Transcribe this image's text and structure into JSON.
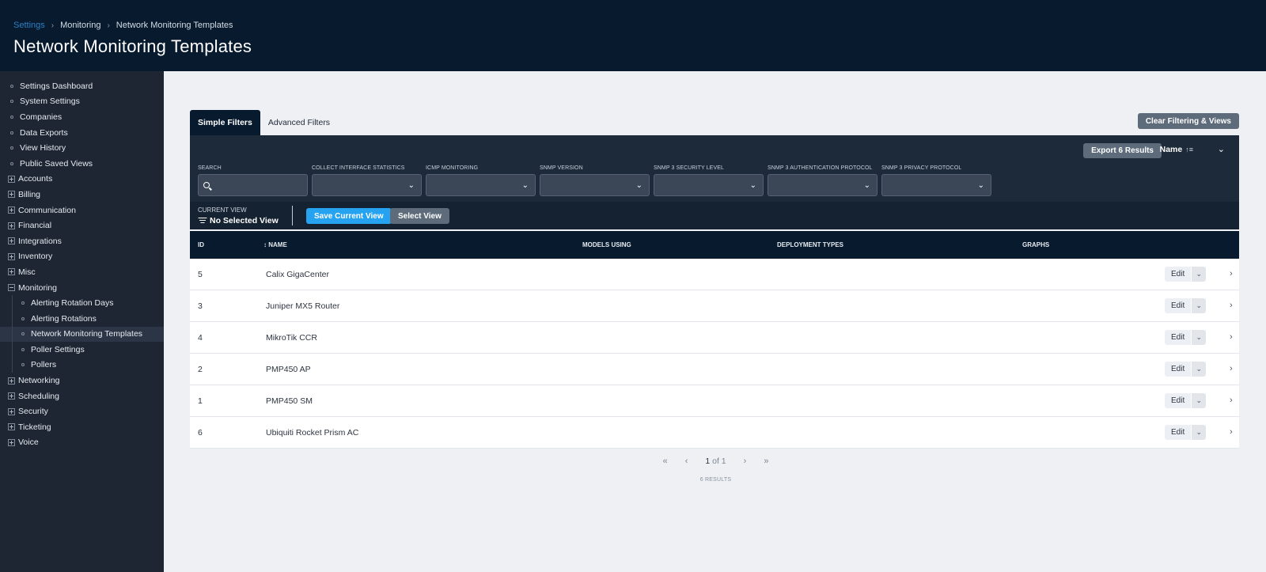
{
  "header": {
    "breadcrumbs": [
      "Settings",
      "Monitoring",
      "Network Monitoring Templates"
    ],
    "breadcrumb_sep": "›",
    "title": "Network Monitoring Templates"
  },
  "sidebar": {
    "items": [
      {
        "label": "Settings Dashboard",
        "type": "leaf"
      },
      {
        "label": "System Settings",
        "type": "leaf"
      },
      {
        "label": "Companies",
        "type": "leaf"
      },
      {
        "label": "Data Exports",
        "type": "leaf"
      },
      {
        "label": "View History",
        "type": "leaf"
      },
      {
        "label": "Public Saved Views",
        "type": "leaf"
      },
      {
        "label": "Accounts",
        "type": "collapsed"
      },
      {
        "label": "Billing",
        "type": "collapsed"
      },
      {
        "label": "Communication",
        "type": "collapsed"
      },
      {
        "label": "Financial",
        "type": "collapsed"
      },
      {
        "label": "Integrations",
        "type": "collapsed"
      },
      {
        "label": "Inventory",
        "type": "collapsed"
      },
      {
        "label": "Misc",
        "type": "collapsed"
      },
      {
        "label": "Monitoring",
        "type": "expanded"
      },
      {
        "label": "Alerting Rotation Days",
        "type": "child"
      },
      {
        "label": "Alerting Rotations",
        "type": "child"
      },
      {
        "label": "Network Monitoring Templates",
        "type": "child",
        "active": true
      },
      {
        "label": "Poller Settings",
        "type": "child"
      },
      {
        "label": "Pollers",
        "type": "child"
      },
      {
        "label": "Networking",
        "type": "collapsed"
      },
      {
        "label": "Scheduling",
        "type": "collapsed"
      },
      {
        "label": "Security",
        "type": "collapsed"
      },
      {
        "label": "Ticketing",
        "type": "collapsed"
      },
      {
        "label": "Voice",
        "type": "collapsed"
      }
    ]
  },
  "tabs": {
    "simple": "Simple Filters",
    "advanced": "Advanced Filters"
  },
  "toolbar": {
    "clear_label": "Clear Filtering & Views",
    "export_label": "Export 6 Results",
    "sort_label": "Name",
    "sort_icon": "↑≡",
    "collapse_icon": "⌄"
  },
  "filters": {
    "search_label": "Search",
    "search_value": "",
    "dropdowns": [
      {
        "label": "Collect Interface Statistics",
        "value": ""
      },
      {
        "label": "ICMP Monitoring",
        "value": ""
      },
      {
        "label": "SNMP Version",
        "value": ""
      },
      {
        "label": "SNMP 3 Security Level",
        "value": ""
      },
      {
        "label": "SNMP 3 Authentication Protocol",
        "value": ""
      },
      {
        "label": "SNMP 3 Privacy Protocol",
        "value": ""
      }
    ]
  },
  "view": {
    "label": "Current View",
    "value": "No Selected View",
    "save_label": "Save Current View",
    "select_label": "Select View"
  },
  "table": {
    "columns": [
      "ID",
      "↕ Name",
      "Models Using",
      "Deployment Types",
      "Graphs"
    ],
    "rows": [
      {
        "id": "5",
        "name": "Calix GigaCenter"
      },
      {
        "id": "3",
        "name": "Juniper MX5 Router"
      },
      {
        "id": "4",
        "name": "MikroTik CCR"
      },
      {
        "id": "2",
        "name": "PMP450 AP"
      },
      {
        "id": "1",
        "name": "PMP450 SM"
      },
      {
        "id": "6",
        "name": "Ubiquiti Rocket Prism AC"
      }
    ],
    "edit_label": "Edit"
  },
  "pagination": {
    "first": "«",
    "prev": "‹",
    "current": "1",
    "of_label": "of 1",
    "next": "›",
    "last": "»",
    "results": "6 Results"
  }
}
